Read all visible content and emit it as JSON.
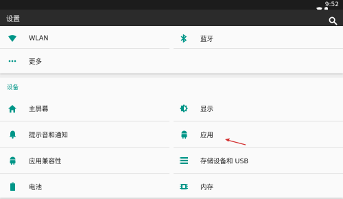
{
  "status_bar": {
    "time": "9:52",
    "icons": [
      "wifi-icon",
      "battery-icon"
    ]
  },
  "app_bar": {
    "title": "设置",
    "search_icon": "search-icon"
  },
  "wireless_card": {
    "items": [
      {
        "label": "WLAN",
        "icon": "wifi-icon"
      },
      {
        "label": "蓝牙",
        "icon": "bluetooth-icon"
      },
      {
        "label": "更多",
        "icon": "more-icon"
      }
    ]
  },
  "device_section": {
    "header": "设备",
    "items": [
      {
        "label": "主屏幕",
        "icon": "home-icon"
      },
      {
        "label": "显示",
        "icon": "brightness-icon"
      },
      {
        "label": "提示音和通知",
        "icon": "bell-icon"
      },
      {
        "label": "应用",
        "icon": "android-icon"
      },
      {
        "label": "应用兼容性",
        "icon": "android-icon"
      },
      {
        "label": "存储设备和 USB",
        "icon": "storage-icon"
      },
      {
        "label": "电池",
        "icon": "battery-icon"
      },
      {
        "label": "内存",
        "icon": "memory-icon"
      }
    ]
  },
  "colors": {
    "accent": "#009688",
    "toolbar": "#2b2b2b",
    "status": "#1c1c1c",
    "annotation_arrow": "#d32f2f"
  }
}
